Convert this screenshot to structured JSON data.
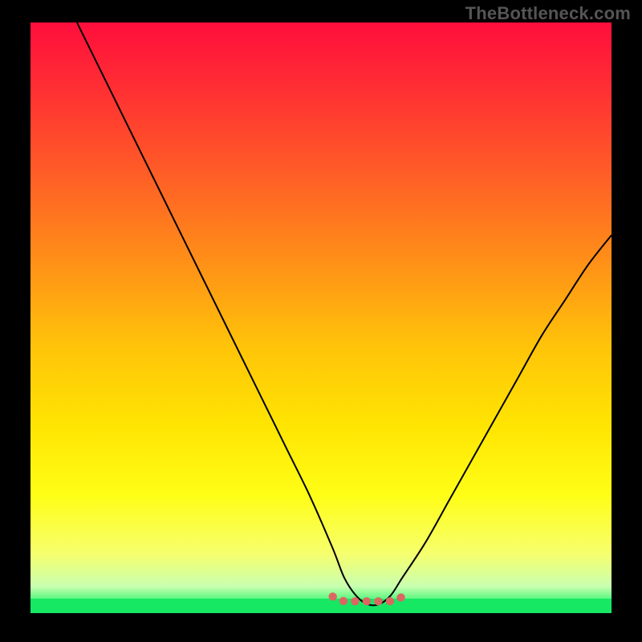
{
  "watermark": {
    "text": "TheBottleneck.com"
  },
  "colors": {
    "border": "#000000",
    "curve": "#000000",
    "flat_marker": "#DC6661",
    "bottom_band": "#16E864",
    "gradient_stops": [
      {
        "offset": 0.0,
        "color": "#FF0E3C"
      },
      {
        "offset": 0.1,
        "color": "#FF2B34"
      },
      {
        "offset": 0.25,
        "color": "#FF5B27"
      },
      {
        "offset": 0.4,
        "color": "#FF8E18"
      },
      {
        "offset": 0.55,
        "color": "#FFC409"
      },
      {
        "offset": 0.68,
        "color": "#FFE402"
      },
      {
        "offset": 0.8,
        "color": "#FFFE16"
      },
      {
        "offset": 0.9,
        "color": "#F6FF6E"
      },
      {
        "offset": 0.955,
        "color": "#C9FFB0"
      },
      {
        "offset": 0.975,
        "color": "#60F882"
      },
      {
        "offset": 1.0,
        "color": "#16E864"
      }
    ]
  },
  "chart_data": {
    "type": "line",
    "title": "",
    "xlabel": "",
    "ylabel": "",
    "xlim": [
      0,
      100
    ],
    "ylim": [
      0,
      100
    ],
    "grid": false,
    "legend": false,
    "series": [
      {
        "name": "bottleneck-curve",
        "x": [
          8,
          12,
          16,
          20,
          24,
          28,
          32,
          36,
          40,
          44,
          48,
          52,
          54,
          56,
          58,
          60,
          62,
          64,
          68,
          72,
          76,
          80,
          84,
          88,
          92,
          96,
          100
        ],
        "values": [
          100,
          92,
          84,
          76,
          68,
          60,
          52,
          44,
          36,
          28,
          20,
          11,
          6,
          3,
          1.5,
          1.5,
          3,
          6,
          12,
          19,
          26,
          33,
          40,
          47,
          53,
          59,
          64
        ]
      }
    ],
    "annotations": [
      {
        "name": "flat-minimum-marker",
        "x_start": 52,
        "x_end": 64,
        "y": 2
      }
    ]
  }
}
